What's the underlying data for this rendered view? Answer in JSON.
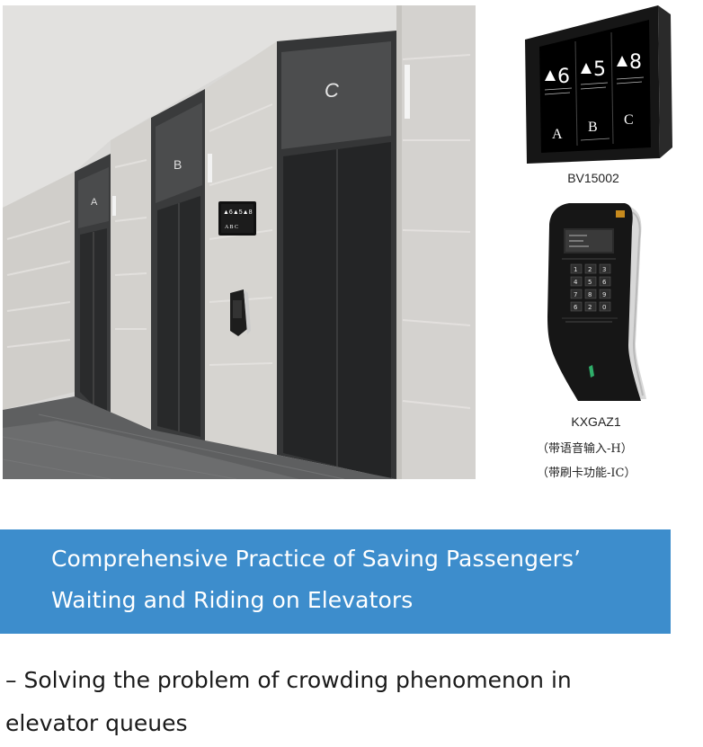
{
  "illustration": {
    "elevator_labels": [
      "A",
      "B",
      "C"
    ],
    "wall_display_icon": "elevator-dispatch-display-icon",
    "wall_keypad_icon": "destination-keypad-icon"
  },
  "products": [
    {
      "model": "BV15002",
      "screen": {
        "cars": [
          {
            "floor": "6",
            "car": "A"
          },
          {
            "floor": "5",
            "car": "B"
          },
          {
            "floor": "8",
            "car": "C"
          }
        ]
      }
    },
    {
      "model": "KXGAZ1",
      "notes": [
        "（带语音输入-H）",
        "（带刷卡功能-IC）"
      ]
    }
  ],
  "banner": {
    "title_line1": "Comprehensive Practice of Saving Passengers’",
    "title_line2": "Waiting and Riding on Elevators",
    "background": "#3d8dcc"
  },
  "subtitle": {
    "line1": "– Solving the problem of crowding phenomenon in",
    "line2": "elevator queues"
  }
}
